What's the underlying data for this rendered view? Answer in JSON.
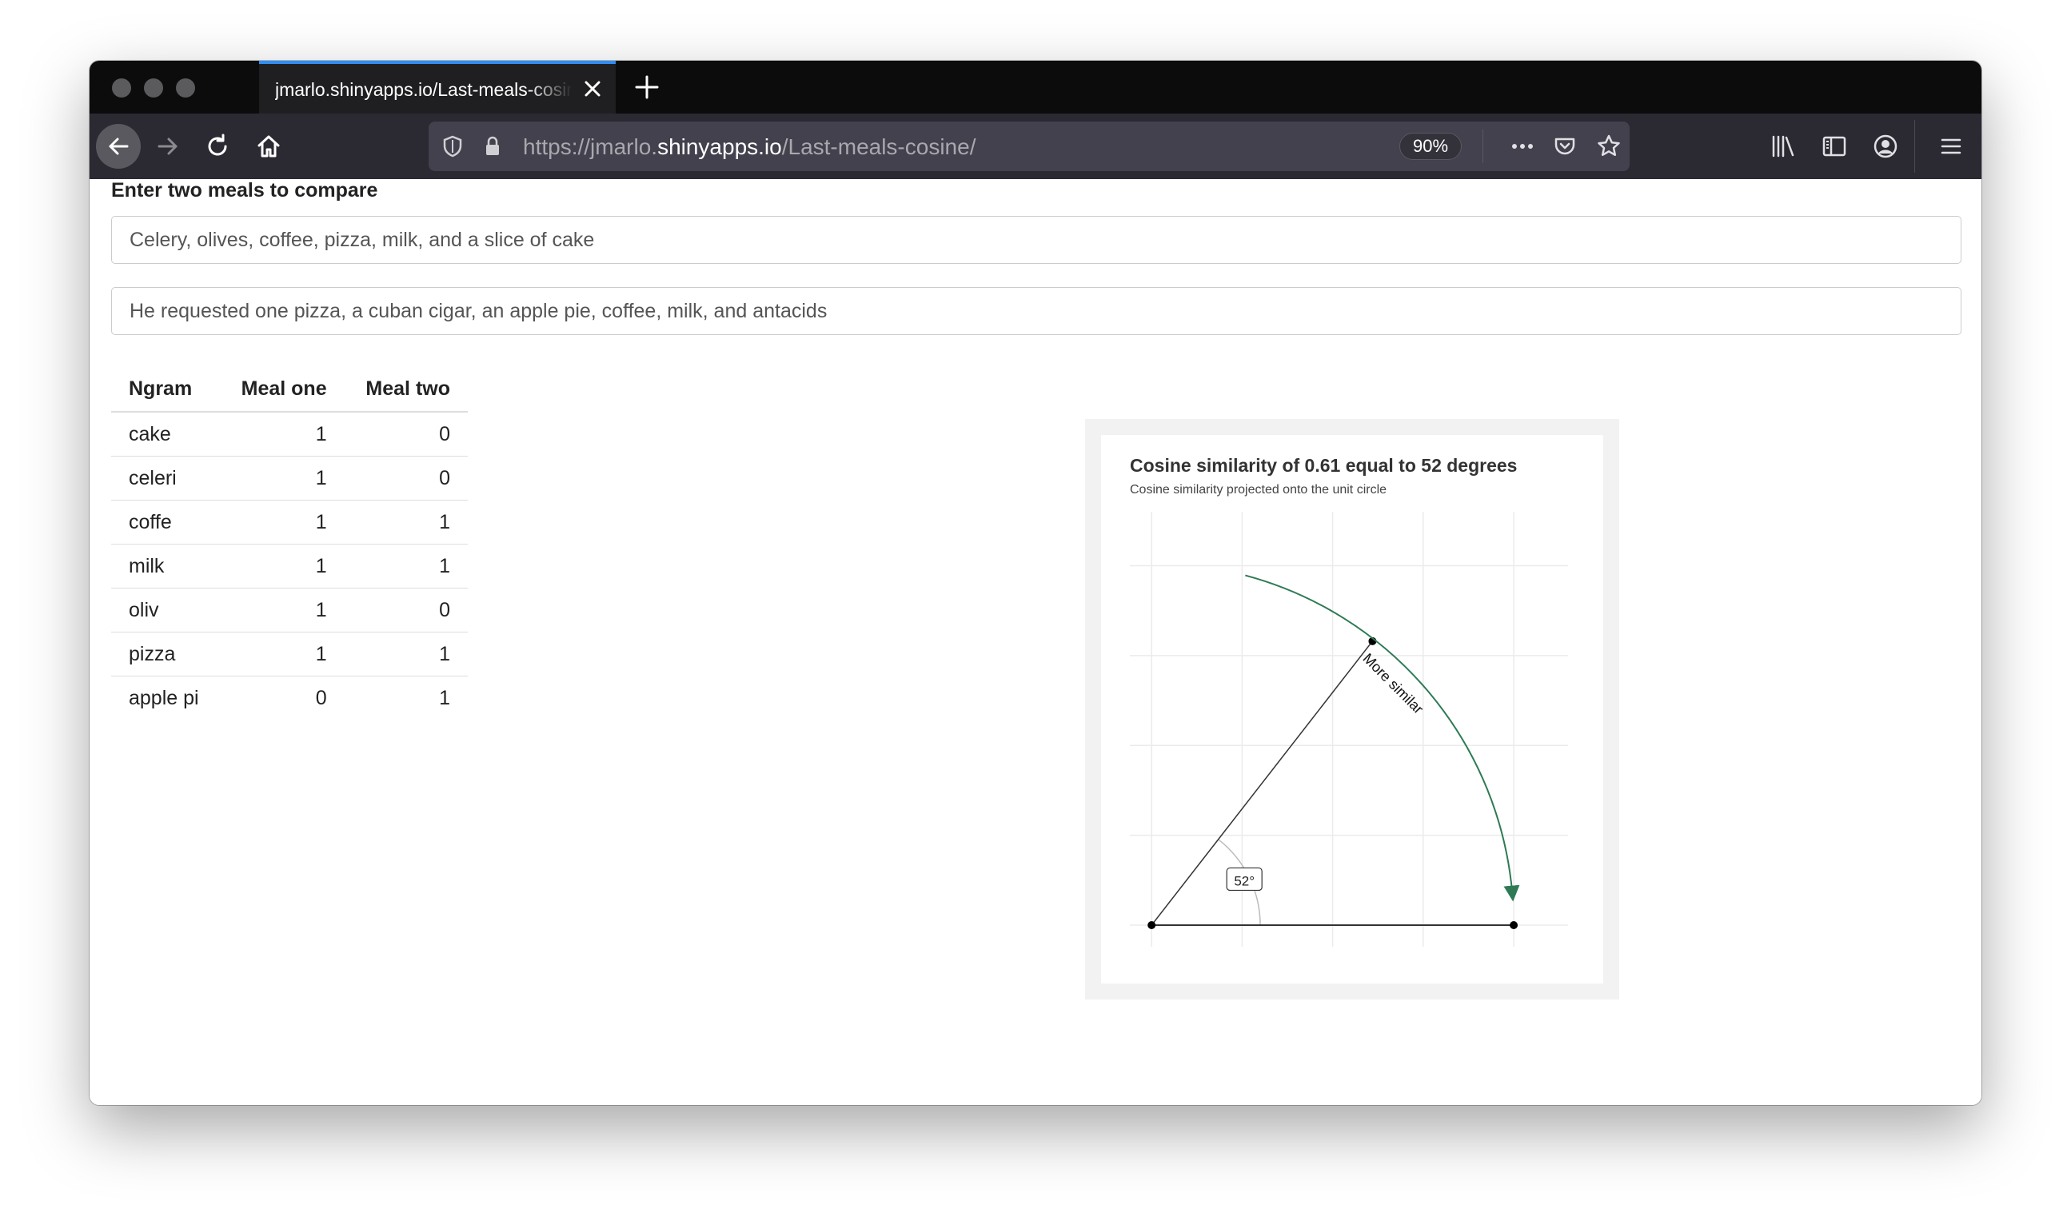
{
  "browser": {
    "tab_title": "jmarlo.shinyapps.io/Last-meals-cosine/",
    "url_prefix": "https://jmarlo.",
    "url_host": "shinyapps.io",
    "url_path": "/Last-meals-cosine/",
    "zoom": "90%"
  },
  "page": {
    "heading": "Enter two meals to compare",
    "meal_one": "Celery, olives, coffee, pizza, milk, and a slice of cake",
    "meal_two": "He requested one pizza, a cuban cigar, an apple pie, coffee, milk, and antacids"
  },
  "table": {
    "headers": [
      "Ngram",
      "Meal one",
      "Meal two"
    ],
    "rows": [
      {
        "ngram": "cake",
        "one": "1",
        "two": "0"
      },
      {
        "ngram": "celeri",
        "one": "1",
        "two": "0"
      },
      {
        "ngram": "coffe",
        "one": "1",
        "two": "1"
      },
      {
        "ngram": "milk",
        "one": "1",
        "two": "1"
      },
      {
        "ngram": "oliv",
        "one": "1",
        "two": "0"
      },
      {
        "ngram": "pizza",
        "one": "1",
        "two": "1"
      },
      {
        "ngram": "apple pi",
        "one": "0",
        "two": "1"
      }
    ]
  },
  "chart_data": {
    "type": "line",
    "title": "Cosine similarity of 0.61 equal to 52 degrees",
    "subtitle": "Cosine similarity projected onto the unit circle",
    "cosine_similarity": 0.61,
    "angle_degrees": 52,
    "angle_label": "52°",
    "arrow_label": "More similar",
    "vector_one": {
      "x": 1,
      "y": 0
    },
    "vector_two": {
      "x": 0.61,
      "y": 0.79
    },
    "arc_from_degrees": 75,
    "arc_to_degrees": 5,
    "xlim": [
      -0.06,
      1.15
    ],
    "ylim": [
      -0.06,
      1.15
    ],
    "grid": true,
    "colors": {
      "arrow": "#2e7a55",
      "vector": "#333333",
      "grid": "#ebebeb"
    }
  }
}
